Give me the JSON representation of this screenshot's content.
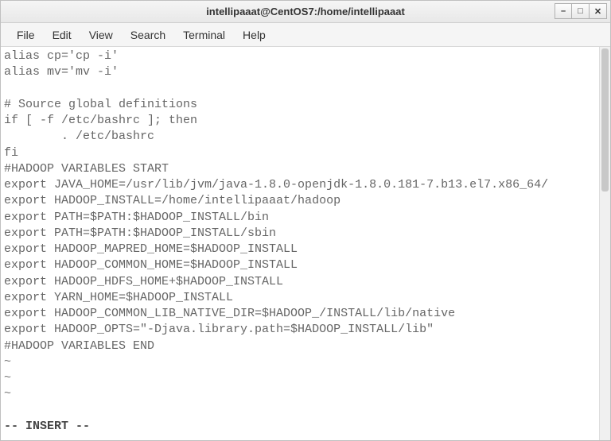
{
  "titlebar": {
    "title": "intellipaaat@CentOS7:/home/intellipaaat"
  },
  "window_controls": {
    "minimize": "–",
    "maximize": "□",
    "close": "✕"
  },
  "menubar": {
    "file": "File",
    "edit": "Edit",
    "view": "View",
    "search": "Search",
    "terminal": "Terminal",
    "help": "Help"
  },
  "terminal": {
    "lines": "alias cp='cp -i'\nalias mv='mv -i'\n\n# Source global definitions\nif [ -f /etc/bashrc ]; then\n        . /etc/bashrc\nfi\n#HADOOP VARIABLES START\nexport JAVA_HOME=/usr/lib/jvm/java-1.8.0-openjdk-1.8.0.181-7.b13.el7.x86_64/\nexport HADOOP_INSTALL=/home/intellipaaat/hadoop\nexport PATH=$PATH:$HADOOP_INSTALL/bin\nexport PATH=$PATH:$HADOOP_INSTALL/sbin\nexport HADOOP_MAPRED_HOME=$HADOOP_INSTALL\nexport HADOOP_COMMON_HOME=$HADOOP_INSTALL\nexport HADOOP_HDFS_HOME+$HADOOP_INSTALL\nexport YARN_HOME=$HADOOP_INSTALL\nexport HADOOP_COMMON_LIB_NATIVE_DIR=$HADOOP_/INSTALL/lib/native\nexport HADOOP_OPTS=\"-Djava.library.path=$HADOOP_INSTALL/lib\"\n#HADOOP VARIABLES END",
    "tilde1": "~",
    "tilde2": "~",
    "tilde3": "~",
    "status": "-- INSERT --"
  }
}
